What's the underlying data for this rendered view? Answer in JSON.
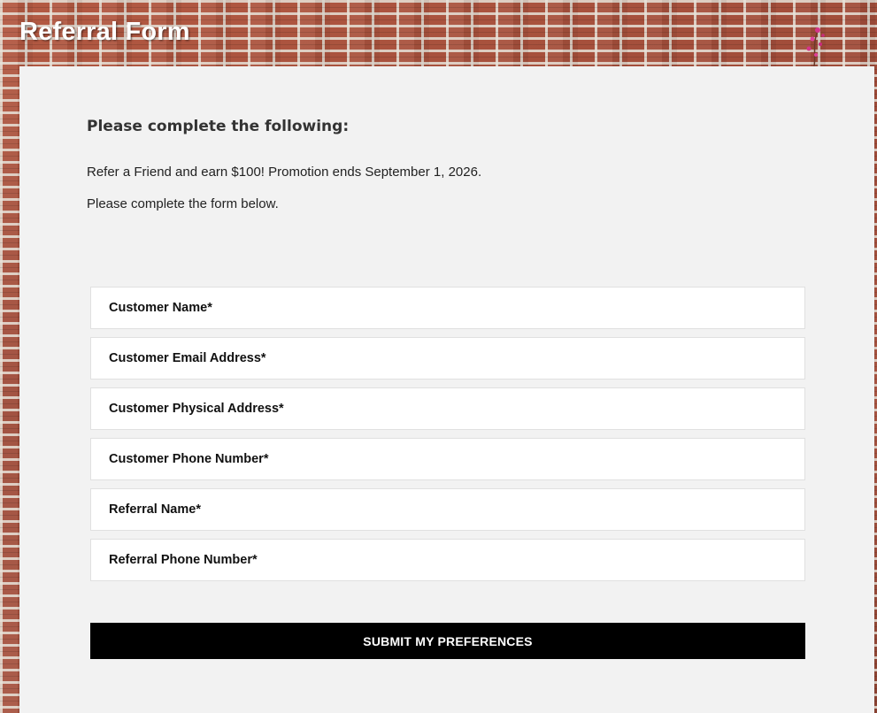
{
  "page": {
    "title": "Referral Form"
  },
  "content": {
    "heading": "Please complete the following:",
    "promo_text": "Refer a Friend and earn $100! Promotion ends September 1, 2026.",
    "instruction_text": "Please complete the form below."
  },
  "form": {
    "fields": [
      {
        "label": "Customer Name*"
      },
      {
        "label": "Customer Email Address*"
      },
      {
        "label": "Customer Physical Address*"
      },
      {
        "label": "Customer Phone Number*"
      },
      {
        "label": "Referral Name*"
      },
      {
        "label": "Referral Phone Number*"
      }
    ],
    "submit_label": "SUBMIT MY PREFERENCES"
  },
  "colors": {
    "panel_background": "#f2f2f2",
    "button_background": "#000000",
    "button_text": "#ffffff",
    "title_text": "#ffffff"
  }
}
